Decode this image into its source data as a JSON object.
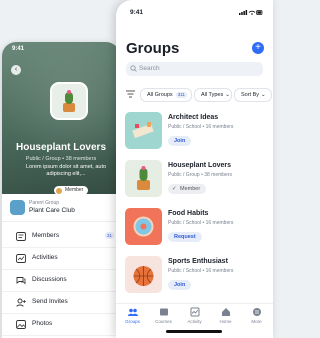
{
  "back_screen": {
    "time": "9:41",
    "group_title": "Houseplant Lovers",
    "group_meta": "Public / Group • 38 members",
    "description": "Lorem ipsum dolor sit amet, auto adipiscing elit,...",
    "member_label": "Member",
    "parent": {
      "label": "Parent Group",
      "name": "Plant Care Club"
    },
    "menu": [
      {
        "label": "Members",
        "icon": "members-icon",
        "count": "31"
      },
      {
        "label": "Activities",
        "icon": "activities-icon"
      },
      {
        "label": "Discussions",
        "icon": "discussions-icon"
      },
      {
        "label": "Send Invites",
        "icon": "send-invites-icon"
      },
      {
        "label": "Photos",
        "icon": "photos-icon"
      }
    ]
  },
  "front_screen": {
    "time": "9:41",
    "title": "Groups",
    "search_placeholder": "Search",
    "filters": {
      "all_groups": "All Groups",
      "all_groups_count": "311",
      "all_types": "All Types",
      "sort_by": "Sort By"
    },
    "groups": [
      {
        "name": "Architect Ideas",
        "meta": "Public / School  •  16 members",
        "action": "Join"
      },
      {
        "name": "Houseplant Lovers",
        "meta": "Public / Group  •  38 members",
        "action": "Member"
      },
      {
        "name": "Food Habits",
        "meta": "Public / School  •  16 members",
        "action": "Request"
      },
      {
        "name": "Sports Enthusiast",
        "meta": "Public / School  •  16 members",
        "action": "Join"
      }
    ],
    "tabs": [
      {
        "label": "Groups",
        "icon": "groups-icon",
        "active": true
      },
      {
        "label": "Courses",
        "icon": "courses-icon"
      },
      {
        "label": "Activity",
        "icon": "activity-icon"
      },
      {
        "label": "Home",
        "icon": "home-icon"
      },
      {
        "label": "More",
        "icon": "more-icon"
      }
    ]
  },
  "colors": {
    "accent": "#2f6cf6",
    "hero": "#4a6a5c"
  }
}
